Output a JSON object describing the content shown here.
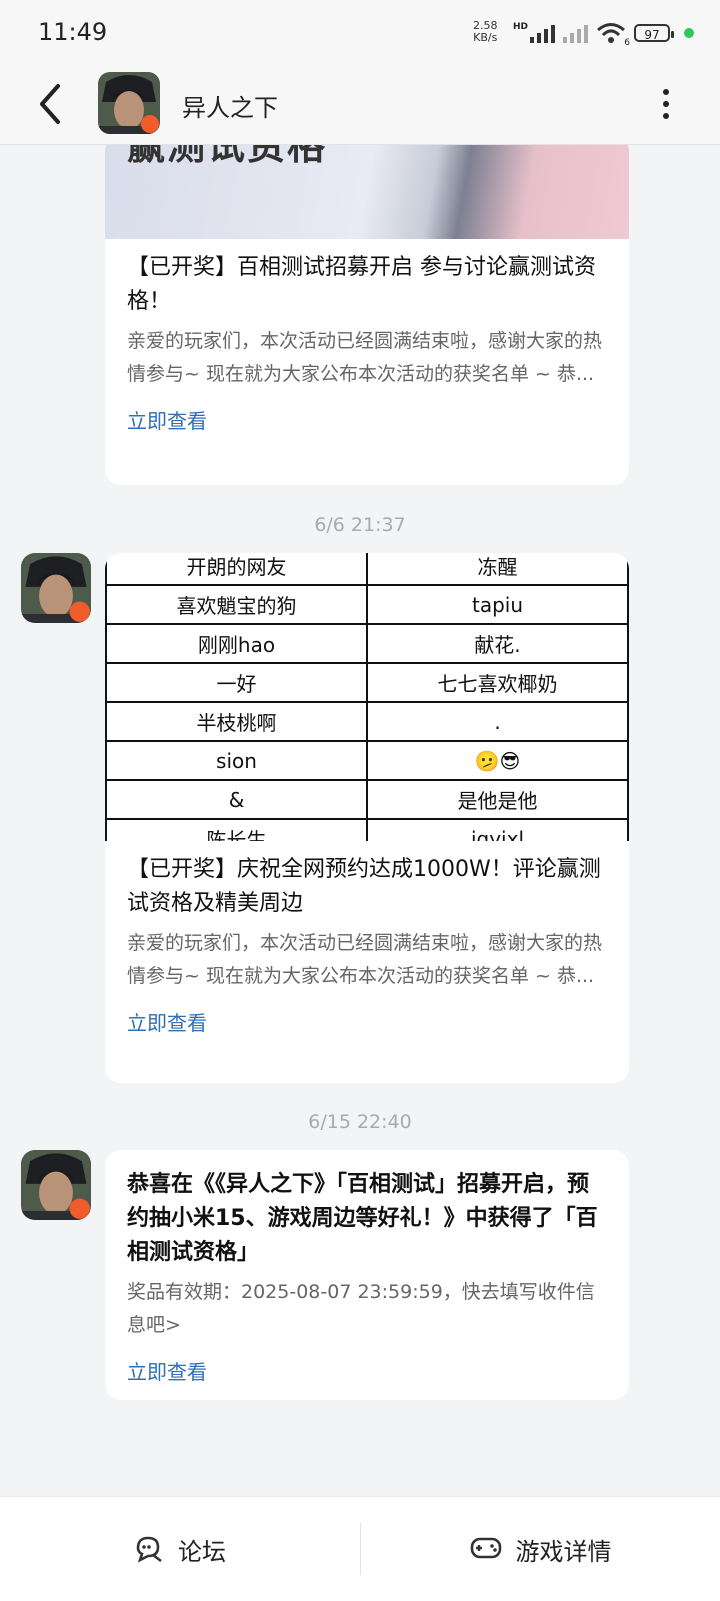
{
  "status_bar": {
    "time": "11:49",
    "net_speed_value": "2.58",
    "net_speed_unit": "KB/s",
    "net_badge": "HD",
    "wifi_badge": "6",
    "battery": "97"
  },
  "header": {
    "title": "异人之下"
  },
  "cards": [
    {
      "banner_text": "赢测试资格",
      "title": "【已开奖】百相测试招募开启 参与讨论赢测试资格！",
      "desc": "亲爱的玩家们，本次活动已经圆满结束啦，感谢大家的热情参与~ 现在就为大家公布本次活动的获奖名单 ~ 恭...",
      "link": "立即查看"
    },
    {
      "timestamp": "6/6  21:37",
      "table": [
        [
          "开朗的网友",
          "冻醒"
        ],
        [
          "喜欢魈宝的狗",
          "tapiu"
        ],
        [
          "刚刚hao",
          "献花."
        ],
        [
          "一好",
          "七七喜欢椰奶"
        ],
        [
          "半枝桃啊",
          "."
        ],
        [
          "sion",
          "🫤😎"
        ],
        [
          "&",
          "是他是他"
        ],
        [
          "陈长生",
          "jqyixl"
        ]
      ],
      "title": "【已开奖】庆祝全网预约达成1000W！评论赢测试资格及精美周边",
      "desc": "亲爱的玩家们，本次活动已经圆满结束啦，感谢大家的热情参与~ 现在就为大家公布本次活动的获奖名单 ~ 恭...",
      "link": "立即查看"
    },
    {
      "timestamp": "6/15  22:40",
      "title": "恭喜在《《异人之下》「百相测试」招募开启，预约抽小米15、游戏周边等好礼！》中获得了「百相测试资格」",
      "desc": "奖品有效期：2025-08-07 23:59:59，快去填写收件信息吧>",
      "link": "立即查看"
    }
  ],
  "bottom_bar": {
    "forum_label": "论坛",
    "game_detail_label": "游戏详情"
  },
  "colors": {
    "link": "#2f6fb8",
    "background": "#f3f4f6",
    "status_dot": "#31c65b"
  },
  "icons": [
    "back-arrow-icon",
    "more-vertical-icon",
    "forum-chat-icon",
    "gamepad-icon",
    "wifi-icon",
    "signal-icon",
    "battery-icon"
  ]
}
